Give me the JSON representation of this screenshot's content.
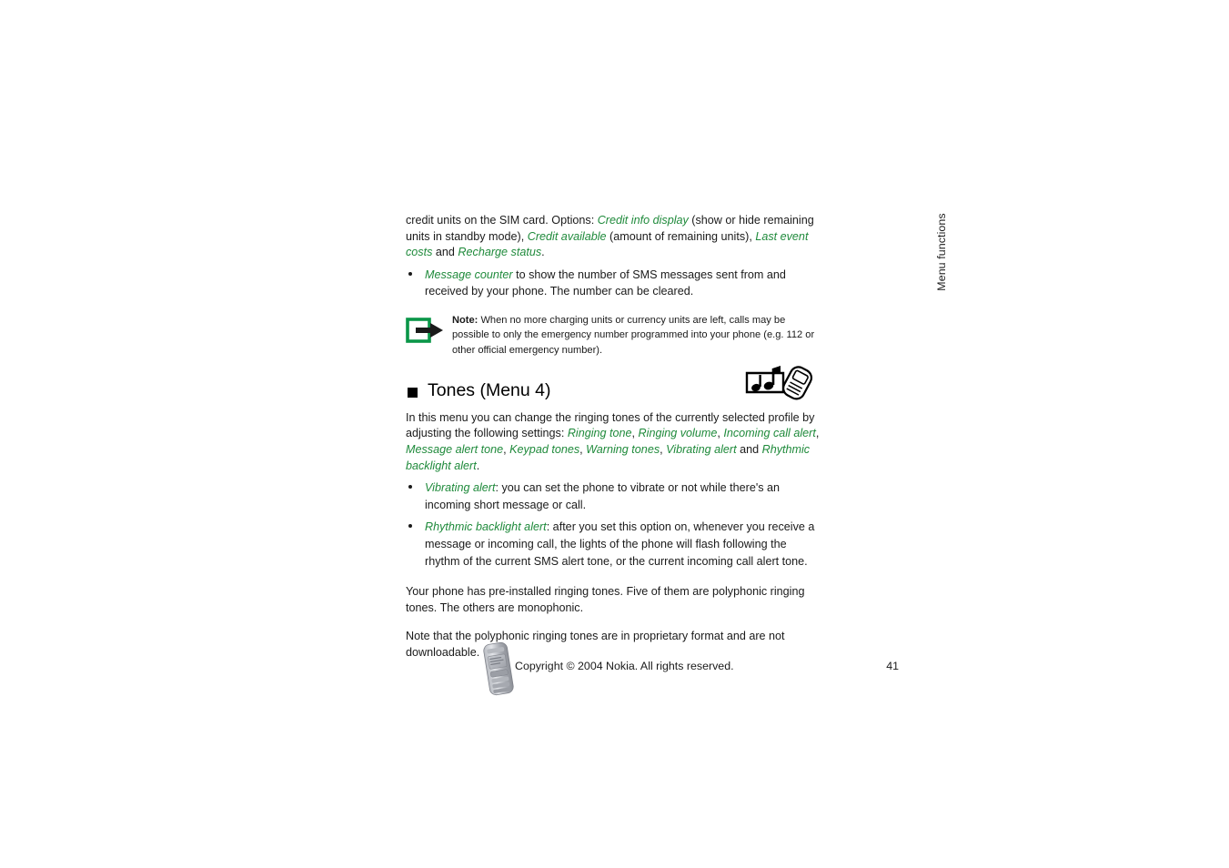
{
  "page": {
    "number": "41",
    "side_tab_label": "Menu functions"
  },
  "intro": {
    "paragraph_parts": [
      {
        "text": "credit units on the SIM card. Options: ",
        "style": "normal"
      },
      {
        "text": "Credit info display",
        "style": "green-italic"
      },
      {
        "text": " (show or hide remaining units in standby mode), ",
        "style": "normal"
      },
      {
        "text": "Credit available",
        "style": "green-italic"
      },
      {
        "text": " (amount of remaining units), ",
        "style": "normal"
      },
      {
        "text": "Last event costs",
        "style": "green-italic"
      },
      {
        "text": " and ",
        "style": "normal"
      },
      {
        "text": "Recharge status",
        "style": "green-italic"
      },
      {
        "text": ".",
        "style": "normal"
      }
    ],
    "p1_a": "credit units on the SIM card. Options: ",
    "p1_green1": "Credit info display",
    "p1_b": " (show or hide remaining units in standby mode), ",
    "p1_green2": "Credit available",
    "p1_c": " (amount of remaining units), ",
    "p1_green3": "Last event costs",
    "p1_d": " and ",
    "p1_green4": "Recharge status",
    "p1_e": "."
  },
  "message_counter_bullet": {
    "green_term": "Message counter",
    "text": " to show the number of SMS messages sent from and received by your phone. The number can be cleared."
  },
  "note": {
    "icon_name": "note-arrow-icon",
    "label": "Note:",
    "text": " When no more charging units or currency units are left, calls may be possible to only the emergency number programmed into your phone (e.g. 112 or other official emergency number)."
  },
  "tones_section": {
    "heading": "Tones (Menu 4)",
    "icon_name": "tones-notes-phone-icon",
    "intro_a": "In this menu you can change the ringing tones of the currently selected profile by adjusting the following settings: ",
    "settings": [
      "Ringing tone",
      "Ringing volume",
      "Incoming call alert",
      "Message alert tone",
      "Keypad tones",
      "Warning tones",
      "Vibrating alert",
      "Rhythmic backlight alert"
    ],
    "setting_1": "Ringing tone",
    "setting_2": "Ringing volume",
    "setting_3": "Incoming call alert",
    "setting_4": "Message alert tone",
    "setting_5": "Keypad tones",
    "setting_6": "Warning tones",
    "setting_7": "Vibrating alert",
    "setting_8": "Rhythmic backlight alert",
    "sep_comma": ", ",
    "sep_and": " and ",
    "sep_period": ".",
    "bullets": [
      {
        "green_term": "Vibrating alert",
        "text": ": you can set the phone to vibrate or not while there's an incoming short message or call."
      },
      {
        "green_term": "Rhythmic backlight alert",
        "text": ": after you set this option on, whenever you receive a message or incoming call, the lights of the phone will flash following the rhythm of the current SMS alert tone, or the current incoming call alert tone."
      }
    ],
    "closing_para_1": "Your phone has pre-installed ringing tones. Five of them are polyphonic ringing tones. The others are monophonic.",
    "closing_para_2": "Note that the polyphonic ringing tones are in proprietary format and are not downloadable."
  },
  "footer": {
    "copyright": "Copyright © 2004 Nokia. All rights reserved.",
    "page_number": "41",
    "phone_image_name": "nokia-phone-photo"
  },
  "colors": {
    "green_term": "#1f8a3b",
    "body_text": "#1a1a1a",
    "background": "#ffffff",
    "note_icon_green": "#0a9648"
  }
}
